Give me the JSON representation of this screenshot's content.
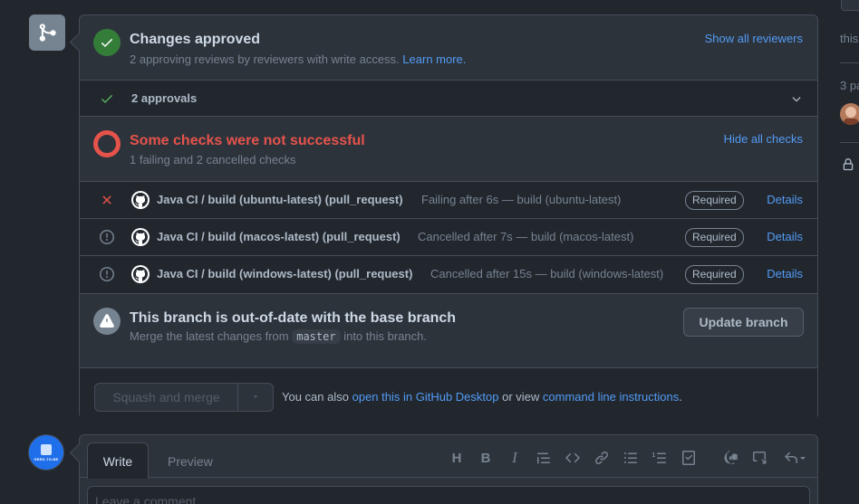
{
  "approved": {
    "title": "Changes approved",
    "subtitle": "2 approving reviews by reviewers with write access.",
    "learn_more": "Learn more.",
    "show_all_reviewers": "Show all reviewers"
  },
  "approvals": {
    "label": "2 approvals"
  },
  "checks": {
    "title": "Some checks were not successful",
    "subtitle": "1 failing and 2 cancelled checks",
    "hide_all": "Hide all checks",
    "items": [
      {
        "status": "failing",
        "name": "Java CI / build (ubuntu-latest) (pull_request)",
        "description": "Failing after 6s — build (ubuntu-latest)",
        "badge": "Required",
        "details": "Details"
      },
      {
        "status": "cancelled",
        "name": "Java CI / build (macos-latest) (pull_request)",
        "description": "Cancelled after 7s — build (macos-latest)",
        "badge": "Required",
        "details": "Details"
      },
      {
        "status": "cancelled",
        "name": "Java CI / build (windows-latest) (pull_request)",
        "description": "Cancelled after 15s — build (windows-latest)",
        "badge": "Required",
        "details": "Details"
      }
    ]
  },
  "branch": {
    "title": "This branch is out-of-date with the base branch",
    "sub_before": "Merge the latest changes from",
    "base": "master",
    "sub_after": "into this branch.",
    "update_button": "Update branch"
  },
  "merge": {
    "squash_button": "Squash and merge",
    "note_prefix": "You can also",
    "desktop_link": "open this in GitHub Desktop",
    "note_middle": "or view",
    "cli_link": "command line instructions",
    "note_suffix": "."
  },
  "comment": {
    "tab_write": "Write",
    "tab_preview": "Preview",
    "placeholder": "Leave a comment"
  },
  "avatar_text": "GEEK-TO-BE",
  "sidebar": {
    "text_1": "this",
    "text_2": "3 pa"
  },
  "colors": {
    "background": "#22272e",
    "surface": "#2d333b",
    "border": "#444c56",
    "link": "#539bf5",
    "success": "#347d39",
    "danger": "#e5534b",
    "muted": "#768390"
  },
  "icons": {
    "merge_badge": "git-merge-icon",
    "approved": "check-circle-icon",
    "approvals_row": "check-icon",
    "expand": "chevron-down-icon",
    "checks": "failing-ring-icon",
    "failing": "x-icon",
    "cancelled": "skip-circle-icon",
    "app": "github-logo-icon",
    "warning": "alert-icon",
    "lock": "lock-icon"
  }
}
